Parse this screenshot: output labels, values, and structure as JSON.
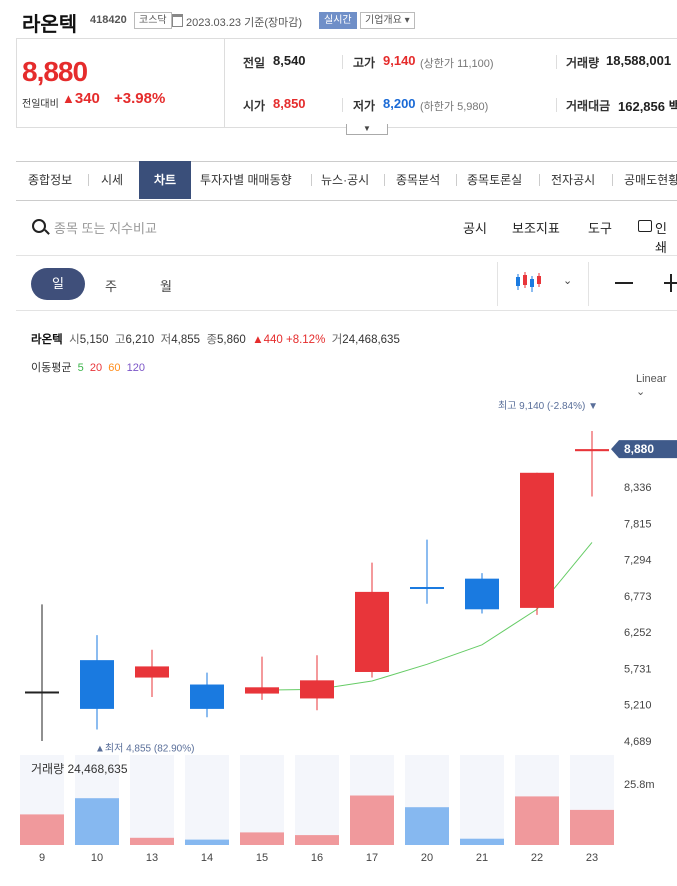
{
  "stock": {
    "name": "라온텍",
    "code": "418420",
    "market_tag": "코스닥",
    "date": "2023.03.23",
    "date_suffix": "기준(장마감)",
    "realtime_tag": "실시간",
    "company_tag": "기업개요 ▾"
  },
  "price": {
    "current": "8,880",
    "change_label": "전일대비",
    "change_arrow": "▲",
    "change_value": "340",
    "change_pct": "+3.98%"
  },
  "info": {
    "prev_label": "전일",
    "prev_value": "8,540",
    "high_label": "고가",
    "high_value": "9,140",
    "upper_limit": "(상한가 11,100)",
    "volume_label": "거래량",
    "volume_value": "18,588,001",
    "open_label": "시가",
    "open_value": "8,850",
    "low_label": "저가",
    "low_value": "8,200",
    "lower_limit": "(하한가 5,980)",
    "amount_label": "거래대금",
    "amount_value": "162,856 백"
  },
  "tabs": [
    "종합정보",
    "시세",
    "차트",
    "투자자별 매매동향",
    "뉴스·공시",
    "종목분석",
    "종목토론실",
    "전자공시",
    "공매도현황"
  ],
  "toolbar": {
    "search_placeholder": "종목 또는 지수비교",
    "disclosure": "공시",
    "indicators": "보조지표",
    "tools": "도구",
    "print": "인쇄"
  },
  "periods": [
    "일",
    "주",
    "월"
  ],
  "legend": {
    "name": "라온텍",
    "open_label": "시",
    "open": "5,150",
    "high_label": "고",
    "high": "6,210",
    "low_label": "저",
    "low": "4,855",
    "close_label": "종",
    "close": "5,860",
    "change": "▲440",
    "pct": "+8.12%",
    "volume_label": "거",
    "volume": "24,468,635",
    "ma_label": "이동평균",
    "ma_periods": [
      "5",
      "20",
      "60",
      "120"
    ],
    "scale_mode": "Linear ⌄"
  },
  "colors": {
    "up": "#e8353a",
    "down": "#1a7ae0",
    "ma5": "#66cc66",
    "ma20": "#e8353a",
    "ma60": "#ff8c1a",
    "ma120": "#7b55c7",
    "accent": "#3f4f7a"
  },
  "chart_data": {
    "type": "candlestick",
    "x": [
      "9",
      "10",
      "13",
      "14",
      "15",
      "16",
      "17",
      "20",
      "21",
      "22",
      "23"
    ],
    "candles": [
      {
        "open": 5400,
        "high": 6650,
        "low": 4689,
        "close": 5400
      },
      {
        "open": 5850,
        "high": 6210,
        "low": 4855,
        "close": 5150
      },
      {
        "open": 5600,
        "high": 6000,
        "low": 5320,
        "close": 5760
      },
      {
        "open": 5500,
        "high": 5670,
        "low": 5030,
        "close": 5150
      },
      {
        "open": 5370,
        "high": 5900,
        "low": 5280,
        "close": 5460
      },
      {
        "open": 5300,
        "high": 5920,
        "low": 5130,
        "close": 5560
      },
      {
        "open": 5680,
        "high": 7250,
        "low": 5600,
        "close": 6830
      },
      {
        "open": 6900,
        "high": 7580,
        "low": 6660,
        "close": 6880
      },
      {
        "open": 7020,
        "high": 7100,
        "low": 6520,
        "close": 6580
      },
      {
        "open": 6600,
        "high": 8540,
        "low": 6500,
        "close": 8540
      },
      {
        "open": 8850,
        "high": 9140,
        "low": 8200,
        "close": 8880
      }
    ],
    "ma5": [
      null,
      null,
      null,
      null,
      5420,
      5430,
      5550,
      5790,
      6070,
      6580,
      7540
    ],
    "volume": [
      0.34,
      0.52,
      0.08,
      0.06,
      0.14,
      0.11,
      0.55,
      0.42,
      0.07,
      0.54,
      0.39
    ],
    "volume_label": "거래량",
    "volume_value": "24,468,635",
    "volume_axis_max": "25.8m",
    "y_ticks": [
      "8,336",
      "7,815",
      "7,294",
      "6,773",
      "6,252",
      "5,731",
      "5,210",
      "4,689"
    ],
    "ylim": [
      4689,
      9140
    ],
    "last_price_label": "8,880",
    "max_label": "최고 9,140 (-2.84%)",
    "min_label": "최저 4,855 (82.90%)"
  }
}
